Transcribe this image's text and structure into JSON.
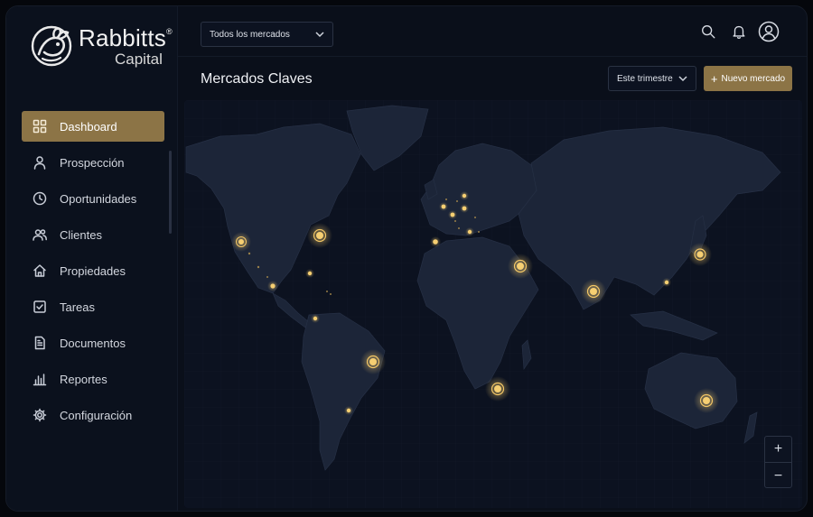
{
  "brand": {
    "name": "Rabbitts",
    "trademark": "®",
    "sub": "Capital"
  },
  "topbar": {
    "market_filter": "Todos los mercados",
    "icons": [
      "search-icon",
      "bell-icon",
      "user-circle-icon"
    ]
  },
  "page": {
    "title": "Mercados Claves",
    "period_filter": "Este trimestre",
    "new_button": "Nuevo mercado"
  },
  "sidebar": {
    "items": [
      {
        "label": "Dashboard",
        "icon": "grid-icon",
        "active": true
      },
      {
        "label": "Prospección",
        "icon": "user-icon",
        "active": false
      },
      {
        "label": "Oportunidades",
        "icon": "clock-icon",
        "active": false
      },
      {
        "label": "Clientes",
        "icon": "users-icon",
        "active": false
      },
      {
        "label": "Propiedades",
        "icon": "home-icon",
        "active": false
      },
      {
        "label": "Tareas",
        "icon": "checkbox-icon",
        "active": false
      },
      {
        "label": "Documentos",
        "icon": "document-icon",
        "active": false
      },
      {
        "label": "Reportes",
        "icon": "bar-chart-icon",
        "active": false
      },
      {
        "label": "Configuración",
        "icon": "gear-icon",
        "active": false
      }
    ]
  },
  "map": {
    "zoom_in": "+",
    "zoom_out": "−",
    "colors": {
      "accent": "#8c7446",
      "marker": "#f3c766",
      "land": "#1b2436",
      "water": "#0c1220"
    }
  }
}
